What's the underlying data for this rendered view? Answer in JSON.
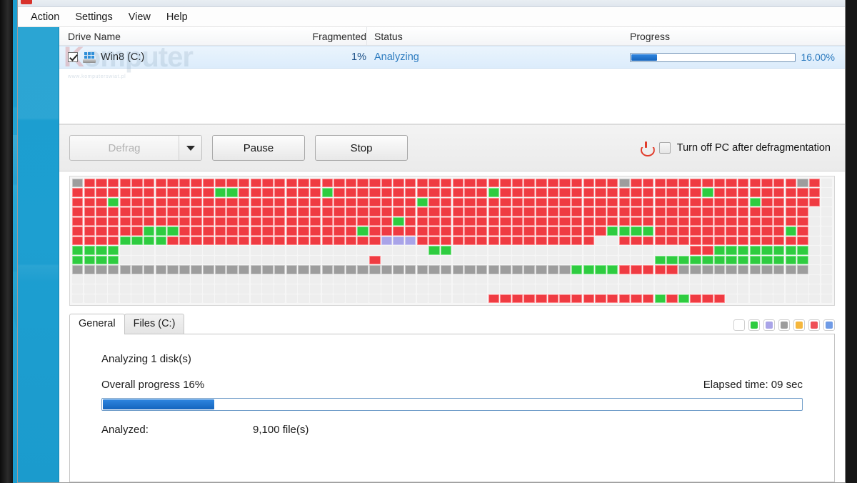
{
  "window": {
    "app_icon": "defrag-app-icon",
    "watermark": "Komputer",
    "watermark_sub": "www.komputerswiat.pl"
  },
  "menu": {
    "items": [
      {
        "label": "Action",
        "name": "menu-action"
      },
      {
        "label": "Settings",
        "name": "menu-settings"
      },
      {
        "label": "View",
        "name": "menu-view"
      },
      {
        "label": "Help",
        "name": "menu-help"
      }
    ]
  },
  "drive_list": {
    "columns": [
      "Drive Name",
      "Fragmented",
      "Status",
      "Progress"
    ],
    "rows": [
      {
        "checked": true,
        "name": "Win8 (C:)",
        "fragmented": "1%",
        "status": "Analyzing",
        "progress_pct": 16,
        "progress_label": "16.00%"
      }
    ]
  },
  "toolbar": {
    "defrag_label": "Defrag",
    "defrag_enabled": false,
    "pause_label": "Pause",
    "stop_label": "Stop",
    "turn_off_label": "Turn off PC after defragmentation",
    "turn_off_checked": false,
    "power_icon_color": "#e13c2b"
  },
  "disk_map": {
    "colors": {
      "free": "#eeeeee",
      "fragmented": "#ef3b42",
      "contiguous": "#2ecc40",
      "system": "#9d9d9d",
      "mft": "#a9a4e8"
    },
    "cols": 64,
    "rows": 13,
    "grid": [
      "gRRRRRRRRRRRRRRRRRRRRRRRRRRRRRRRRRRRRRRRRRRRRRgRRRRRRRRRRRRRRgR",
      "RRRRRRRRRRRRGGRRRRRRRGRRRRRRRRRRRRRGRRRRRRRRRRRRRRRRRGRRRRRRRRR",
      "RRRGRRRRRRRRRRRRRRRRRRRRRRRRRGRRRRRRRRRRRRRRRRRRRRRRRRRRRGRRRRR",
      "RRRRRRRRRRRRRRRRRRRRRRRRRRRRRRRRRRRRRRRRRRRRRRRRRRRRRRRRRRRRRR",
      "RRRRRRRRRRRRRRRRRRRRRRRRRRRGRRRRRRRRRRRRRRRRRRRRRRRRRRRRRRRRRR",
      "RRRRRRGGGRRRRRRRRRRRRRRRGRRRRRRRRRRRRRRRRRRRRGGGGRRRRRRRRRRRGR",
      "RRRRGGGGRRRRRRRRRRRRRRRRRRPPPRRRRRRRRRRRRRRR..RRRRRRRRRRRRRRRR",
      "GGGG..........................GG....................RRGGGGGGGG",
      "GGGG.....................R.......................GGGGGGGGGGGGG",
      "SSSSSSSSSSSSSSSSSSSSSSSSSSSSSSSSSSSSSSSSSSGGGGRRRRRSSSSSSSSSSS",
      "..............................................................",
      "..............................................................",
      "...................................RRRRRRRRRRRRRRGRGRRR........"
    ]
  },
  "tabs": [
    {
      "label": "General",
      "name": "tab-general",
      "active": true
    },
    {
      "label": "Files (C:)",
      "name": "tab-files",
      "active": false
    }
  ],
  "legend": [
    {
      "name": "legend-free",
      "color": "#ffffff"
    },
    {
      "name": "legend-contiguous",
      "color": "#2ecc40"
    },
    {
      "name": "legend-mft",
      "color": "#a9a4e8"
    },
    {
      "name": "legend-system",
      "color": "#9d9d9d"
    },
    {
      "name": "legend-pagefile",
      "color": "#f5b63c"
    },
    {
      "name": "legend-fragmented",
      "color": "#ef4f56"
    },
    {
      "name": "legend-directories",
      "color": "#6f9be6"
    }
  ],
  "general_panel": {
    "analyzing_line": "Analyzing 1 disk(s)",
    "overall_progress_label": "Overall progress 16%",
    "overall_progress_pct": 16,
    "elapsed_time": "Elapsed time: 09 sec",
    "analyzed_key": "Analyzed:",
    "analyzed_value": "9,100 file(s)"
  }
}
